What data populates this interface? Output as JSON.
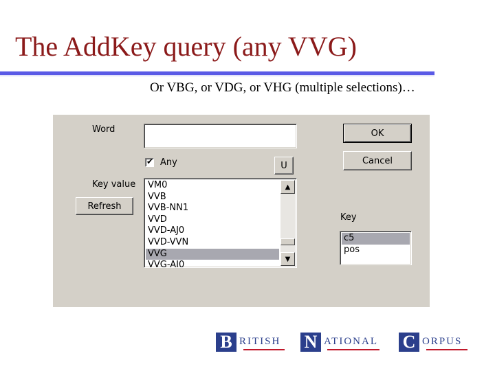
{
  "slide": {
    "title": "The AddKey query (any VVG)",
    "subtitle": "Or VBG, or VDG, or VHG (multiple selections)…"
  },
  "dialog": {
    "word_label": "Word",
    "word_value": "",
    "any_label": "Any",
    "any_checked": true,
    "u_button": "U",
    "key_value_label": "Key value",
    "refresh_button": "Refresh",
    "ok_button": "OK",
    "cancel_button": "Cancel",
    "key_label": "Key",
    "key_value_items": [
      "VM0",
      "VVB",
      "VVB-NN1",
      "VVD",
      "VVD-AJ0",
      "VVD-VVN",
      "VVG",
      "VVG-AJ0"
    ],
    "key_value_selected": "VVG",
    "key_items": [
      "c5",
      "pos"
    ],
    "key_selected": "c5"
  },
  "logo": {
    "b": "B",
    "b_rest": "RITISH",
    "n": "N",
    "n_rest": "ATIONAL",
    "c": "C",
    "c_rest": "ORPUS"
  },
  "colors": {
    "title": "#8b1a1a",
    "rule": "#5a5ae6",
    "dialog_bg": "#d4d0c8",
    "logo_blue": "#2b3f8c",
    "logo_red": "#c0182a"
  }
}
